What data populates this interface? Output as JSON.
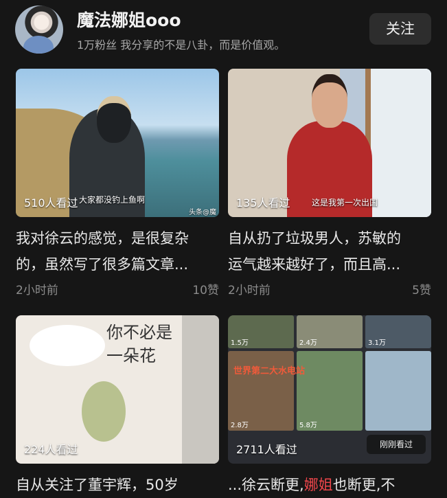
{
  "profile": {
    "name": "魔法娜姐ooo",
    "fans": "1万粉丝",
    "bio": "我分享的不是八卦，而是价值观。",
    "follow_label": "关注"
  },
  "cards": [
    {
      "views": "510人看过",
      "caption": "大家都没钓上鱼啊",
      "watermark": "头条@魔",
      "title_line1": "我对徐云的感觉，是很复杂",
      "title_line2": "的，虽然写了很多篇文章...",
      "time": "2小时前",
      "likes": "10赞"
    },
    {
      "views": "135人看过",
      "caption": "这是我第一次出国",
      "title_line1": "自从扔了垃圾男人，苏敏的",
      "title_line2": "运气越来越好了，而且高...",
      "time": "2小时前",
      "likes": "5赞"
    },
    {
      "views": "224人看过",
      "art_title_line1": "你不必是",
      "art_title_line2": "一朵花",
      "title_line1": "自从关注了董宇辉，50岁"
    },
    {
      "views": "2711人看过",
      "banner": "世界第二大水电站",
      "tile_counts": [
        "1.5万",
        "2.4万",
        "3.1万",
        "2.8万",
        "5.8万"
      ],
      "seen_label": "刚刚看过",
      "title_prefix": "...徐云断更,",
      "title_highlight": "娜姐",
      "title_suffix": "也断更,不"
    }
  ]
}
